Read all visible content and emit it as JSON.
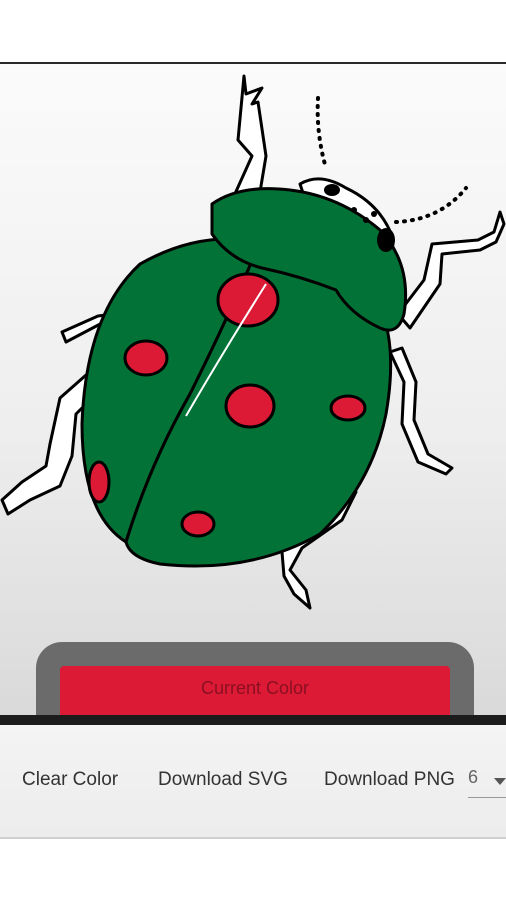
{
  "colors": {
    "body": "#037236",
    "spots": "#dc1a36",
    "outline": "#000000",
    "legs": "#ffffff"
  },
  "color_panel": {
    "label": "Current Color",
    "value": "#dc1a36"
  },
  "toolbar": {
    "clear_label": "Clear Color",
    "download_svg_label": "Download SVG",
    "download_png_label": "Download PNG",
    "size_value": "6"
  }
}
